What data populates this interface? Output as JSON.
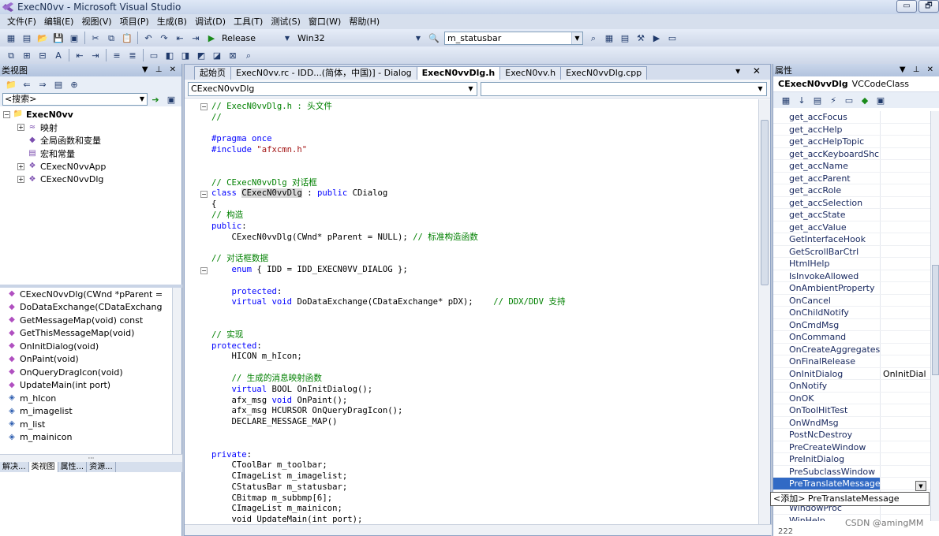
{
  "window": {
    "title": "ExecN0vv - Microsoft Visual Studio",
    "controls": [
      "▭",
      "🗗"
    ]
  },
  "menu": [
    "文件(F)",
    "编辑(E)",
    "视图(V)",
    "项目(P)",
    "生成(B)",
    "调试(D)",
    "工具(T)",
    "测试(S)",
    "窗口(W)",
    "帮助(H)"
  ],
  "toolbar": {
    "config": "Release",
    "platform": "Win32",
    "find_value": "m_statusbar"
  },
  "class_view": {
    "title": "类视图",
    "search_placeholder": "<搜索>",
    "tree": [
      {
        "label": "ExecN0vv",
        "icon": "📁",
        "expander": "⊟",
        "bold": true,
        "indent": 0
      },
      {
        "label": "映射",
        "icon": "≈",
        "expander": "⊞",
        "bold": false,
        "indent": 1
      },
      {
        "label": "全局函数和变量",
        "icon": "◆",
        "expander": "",
        "bold": false,
        "indent": 1
      },
      {
        "label": "宏和常量",
        "icon": "▤",
        "expander": "",
        "bold": false,
        "indent": 1
      },
      {
        "label": "CExecN0vvApp",
        "icon": "❖",
        "expander": "⊞",
        "bold": false,
        "indent": 1
      },
      {
        "label": "CExecN0vvDlg",
        "icon": "❖",
        "expander": "⊞",
        "bold": false,
        "indent": 1
      }
    ],
    "members": [
      "CExecN0vvDlg(CWnd *pParent =",
      "DoDataExchange(CDataExchang",
      "GetMessageMap(void) const",
      "GetThisMessageMap(void)",
      "OnInitDialog(void)",
      "OnPaint(void)",
      "OnQueryDragIcon(void)",
      "UpdateMain(int port)",
      "m_hIcon",
      "m_imagelist",
      "m_list",
      "m_mainicon"
    ],
    "bottom_tabs": [
      "解决...",
      "类视图",
      "属性...",
      "资源..."
    ]
  },
  "editor": {
    "tabs": [
      "起始页",
      "ExecN0vv.rc - IDD...(简体，中国)] - Dialog",
      "ExecN0vvDlg.h",
      "ExecN0vv.h",
      "ExecN0vvDlg.cpp"
    ],
    "active_tab": "ExecN0vvDlg.h",
    "nav_left": "CExecN0vvDlg",
    "nav_right": ""
  },
  "code_lines": [
    [
      [
        "cm",
        "// ExecN0vvDlg.h : 头文件"
      ]
    ],
    [
      [
        "cm",
        "//"
      ]
    ],
    [],
    [
      [
        "pp",
        "#pragma once"
      ]
    ],
    [
      [
        "pp",
        "#include "
      ],
      [
        "st",
        "\"afxcmn.h\""
      ]
    ],
    [],
    [],
    [
      [
        "cm",
        "// CExecN0vvDlg 对话框"
      ]
    ],
    [
      [
        "kw",
        "class "
      ],
      [
        "hl",
        "CExecN0vvDlg"
      ],
      [
        "",
        " : "
      ],
      [
        "kw",
        "public"
      ],
      [
        "",
        " CDialog"
      ]
    ],
    [
      [
        "",
        "{"
      ]
    ],
    [
      [
        "cm",
        "// 构造"
      ]
    ],
    [
      [
        "kw",
        "public"
      ],
      [
        "",
        ":"
      ]
    ],
    [
      [
        "",
        "    CExecN0vvDlg(CWnd* pParent = NULL); "
      ],
      [
        "cm",
        "// 标准构造函数"
      ]
    ],
    [],
    [
      [
        "cm",
        "// 对话框数据"
      ]
    ],
    [
      [
        "kw",
        "    enum"
      ],
      [
        "",
        " { IDD = IDD_EXECN0VV_DIALOG };"
      ]
    ],
    [],
    [
      [
        "kw",
        "    protected"
      ],
      [
        "",
        ":"
      ]
    ],
    [
      [
        "kw",
        "    virtual void"
      ],
      [
        "",
        " DoDataExchange(CDataExchange* pDX);    "
      ],
      [
        "cm",
        "// DDX/DDV 支持"
      ]
    ],
    [],
    [],
    [
      [
        "cm",
        "// 实现"
      ]
    ],
    [
      [
        "kw",
        "protected"
      ],
      [
        "",
        ":"
      ]
    ],
    [
      [
        "",
        "    HICON m_hIcon;"
      ]
    ],
    [],
    [
      [
        "cm",
        "    // 生成的消息映射函数"
      ]
    ],
    [
      [
        "kw",
        "    virtual"
      ],
      [
        "",
        " BOOL OnInitDialog();"
      ]
    ],
    [
      [
        "",
        "    afx_msg "
      ],
      [
        "kw",
        "void"
      ],
      [
        "",
        " OnPaint();"
      ]
    ],
    [
      [
        "",
        "    afx_msg HCURSOR OnQueryDragIcon();"
      ]
    ],
    [
      [
        "",
        "    DECLARE_MESSAGE_MAP()"
      ]
    ],
    [],
    [],
    [
      [
        "kw",
        "private"
      ],
      [
        "",
        ":"
      ]
    ],
    [
      [
        "",
        "    CToolBar m_toolbar;"
      ]
    ],
    [
      [
        "",
        "    CImageList m_imagelist;"
      ]
    ],
    [
      [
        "",
        "    CStatusBar m_statusbar;"
      ]
    ],
    [
      [
        "",
        "    CBitmap m_subbmp[6];"
      ]
    ],
    [
      [
        "",
        "    CImageList m_mainicon;"
      ]
    ],
    [
      [
        "",
        "    void UpdateMain(int port);"
      ]
    ]
  ],
  "properties": {
    "title": "属性",
    "object_name": "CExecN0vvDlg",
    "object_type": "VCCodeClass",
    "rows": [
      {
        "name": "get_accFocus",
        "value": ""
      },
      {
        "name": "get_accHelp",
        "value": ""
      },
      {
        "name": "get_accHelpTopic",
        "value": ""
      },
      {
        "name": "get_accKeyboardShc",
        "value": ""
      },
      {
        "name": "get_accName",
        "value": ""
      },
      {
        "name": "get_accParent",
        "value": ""
      },
      {
        "name": "get_accRole",
        "value": ""
      },
      {
        "name": "get_accSelection",
        "value": ""
      },
      {
        "name": "get_accState",
        "value": ""
      },
      {
        "name": "get_accValue",
        "value": ""
      },
      {
        "name": "GetInterfaceHook",
        "value": ""
      },
      {
        "name": "GetScrollBarCtrl",
        "value": ""
      },
      {
        "name": "HtmlHelp",
        "value": ""
      },
      {
        "name": "IsInvokeAllowed",
        "value": ""
      },
      {
        "name": "OnAmbientProperty",
        "value": ""
      },
      {
        "name": "OnCancel",
        "value": ""
      },
      {
        "name": "OnChildNotify",
        "value": ""
      },
      {
        "name": "OnCmdMsg",
        "value": ""
      },
      {
        "name": "OnCommand",
        "value": ""
      },
      {
        "name": "OnCreateAggregates",
        "value": ""
      },
      {
        "name": "OnFinalRelease",
        "value": ""
      },
      {
        "name": "OnInitDialog",
        "value": "OnInitDial"
      },
      {
        "name": "OnNotify",
        "value": ""
      },
      {
        "name": "OnOK",
        "value": ""
      },
      {
        "name": "OnToolHitTest",
        "value": ""
      },
      {
        "name": "OnWndMsg",
        "value": ""
      },
      {
        "name": "PostNcDestroy",
        "value": ""
      },
      {
        "name": "PreCreateWindow",
        "value": ""
      },
      {
        "name": "PreInitDialog",
        "value": ""
      },
      {
        "name": "PreSubclassWindow",
        "value": ""
      },
      {
        "name": "PreTranslateMessage",
        "value": "",
        "selected": true
      },
      {
        "name": "",
        "value": ""
      },
      {
        "name": "WindowProc",
        "value": ""
      },
      {
        "name": "WinHelp",
        "value": ""
      }
    ],
    "tooltip": "<添加> PreTranslateMessage",
    "footer": "222"
  },
  "watermark": "CSDN @amingMM"
}
